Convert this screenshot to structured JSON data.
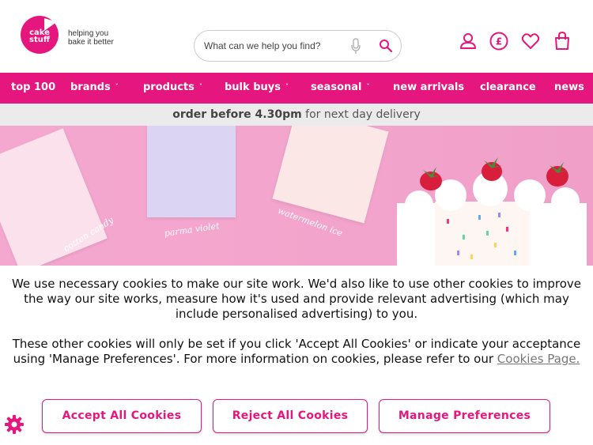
{
  "brand": {
    "logo_text": "cake stuff",
    "tagline_line1": "helping you",
    "tagline_line2": "bake it better",
    "accent_color": "#e5177e"
  },
  "search": {
    "placeholder": "What can we help you find?",
    "mic_icon": "microphone-icon",
    "search_icon": "search-icon"
  },
  "header_icons": [
    "account-icon",
    "currency-pound-icon",
    "wishlist-heart-icon",
    "basket-icon"
  ],
  "nav": {
    "items": [
      {
        "label": "top 100",
        "has_dropdown": false
      },
      {
        "label": "brands",
        "has_dropdown": true
      },
      {
        "label": "products",
        "has_dropdown": true
      },
      {
        "label": "bulk buys",
        "has_dropdown": true
      },
      {
        "label": "seasonal",
        "has_dropdown": true
      },
      {
        "label": "new arrivals",
        "has_dropdown": false
      },
      {
        "label": "clearance",
        "has_dropdown": false
      },
      {
        "label": "news",
        "has_dropdown": false
      }
    ],
    "chevron": "˅"
  },
  "delivery": {
    "bold": "order before 4.30pm",
    "rest": " for next day delivery"
  },
  "hero": {
    "swatches": [
      {
        "label": "cotton candy",
        "color": "#fbe1ec"
      },
      {
        "label": "parma violet",
        "color": "#dcd4f3"
      },
      {
        "label": "watermelon ice",
        "color": "#fbe7e6"
      }
    ]
  },
  "cookie": {
    "para1": "We use necessary cookies to make our site work. We'd also like to use other cookies to improve the way our site works, measure how it's used and provide relevant advertising (which may include personalised advertising) to you.",
    "para2_text": "These other cookies will only be set if you click 'Accept All Cookies' or indicate your acceptance using 'Manage Preferences'. For more information on cookies, please refer to our ",
    "para2_link": "Cookies Page.",
    "accept_label": "Accept All Cookies",
    "reject_label": "Reject All Cookies",
    "manage_label": "Manage Preferences",
    "settings_icon": "gear-icon"
  }
}
